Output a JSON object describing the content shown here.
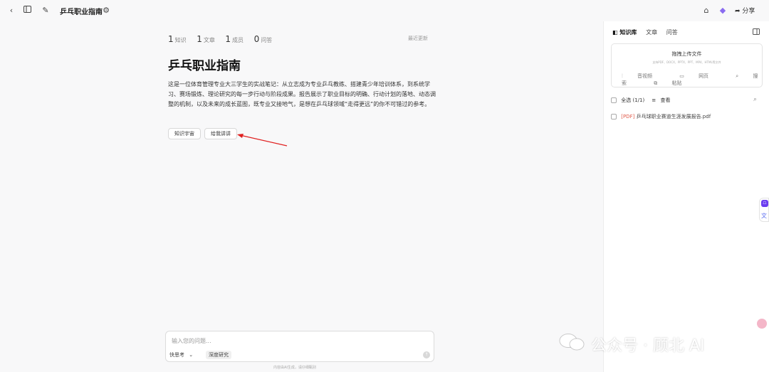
{
  "topbar": {
    "title": "乒乓职业指南",
    "share_label": "分享",
    "icons": [
      "back-icon",
      "sidebar-toggle-icon",
      "edit-icon",
      "settings-icon",
      "home-icon",
      "gem-icon",
      "share-icon"
    ]
  },
  "stats": [
    {
      "count": "1",
      "label": "知识"
    },
    {
      "count": "1",
      "label": "文章"
    },
    {
      "count": "1",
      "label": "成员"
    },
    {
      "count": "0",
      "label": "问答"
    }
  ],
  "recent_label": "最近更新",
  "page_title": "乒乓职业指南",
  "description": "这是一位体育管理专业大三学生的实战笔记：从立志成为专业乒乓教练、搭建青少年培训体系，到系统学习、赛场锻炼、理论研究的每一步行动与阶段成果。报告展示了职业目标的明确、行动计划的落地、动态调整的机制，以及未来的成长蓝图，既专业又接地气，是想在乒乓球领域“走得更远”的你不可错过的参考。",
  "buttons": {
    "knowledge_universe": "知识宇宙",
    "explain_to_me": "给我讲讲"
  },
  "composer": {
    "placeholder": "输入您的问题...",
    "mode": "快思考",
    "deep_research": "深度研究",
    "disclaimer": "内容由AI生成，请仔细甄别"
  },
  "right_panel": {
    "tabs": [
      "知识库",
      "文章",
      "问答"
    ],
    "upload_title": "拖拽上传文件",
    "upload_sub": "支持PDF、DOCX、PPTX、PPT、MP4、HTML等文件",
    "actions": [
      "音视频",
      "网页",
      "搜索",
      "粘贴"
    ],
    "select_all": "全选 (1/1)",
    "view": "查看",
    "files": [
      {
        "tag": "[PDF]",
        "name": "乒乓球职业赛道生涯发展报告.pdf"
      }
    ]
  },
  "watermark": "公众号 · 顾北 AI",
  "colors": {
    "accent": "#6a3cf0",
    "arrow": "#e02020",
    "pdf_tag": "#e05b4b"
  }
}
